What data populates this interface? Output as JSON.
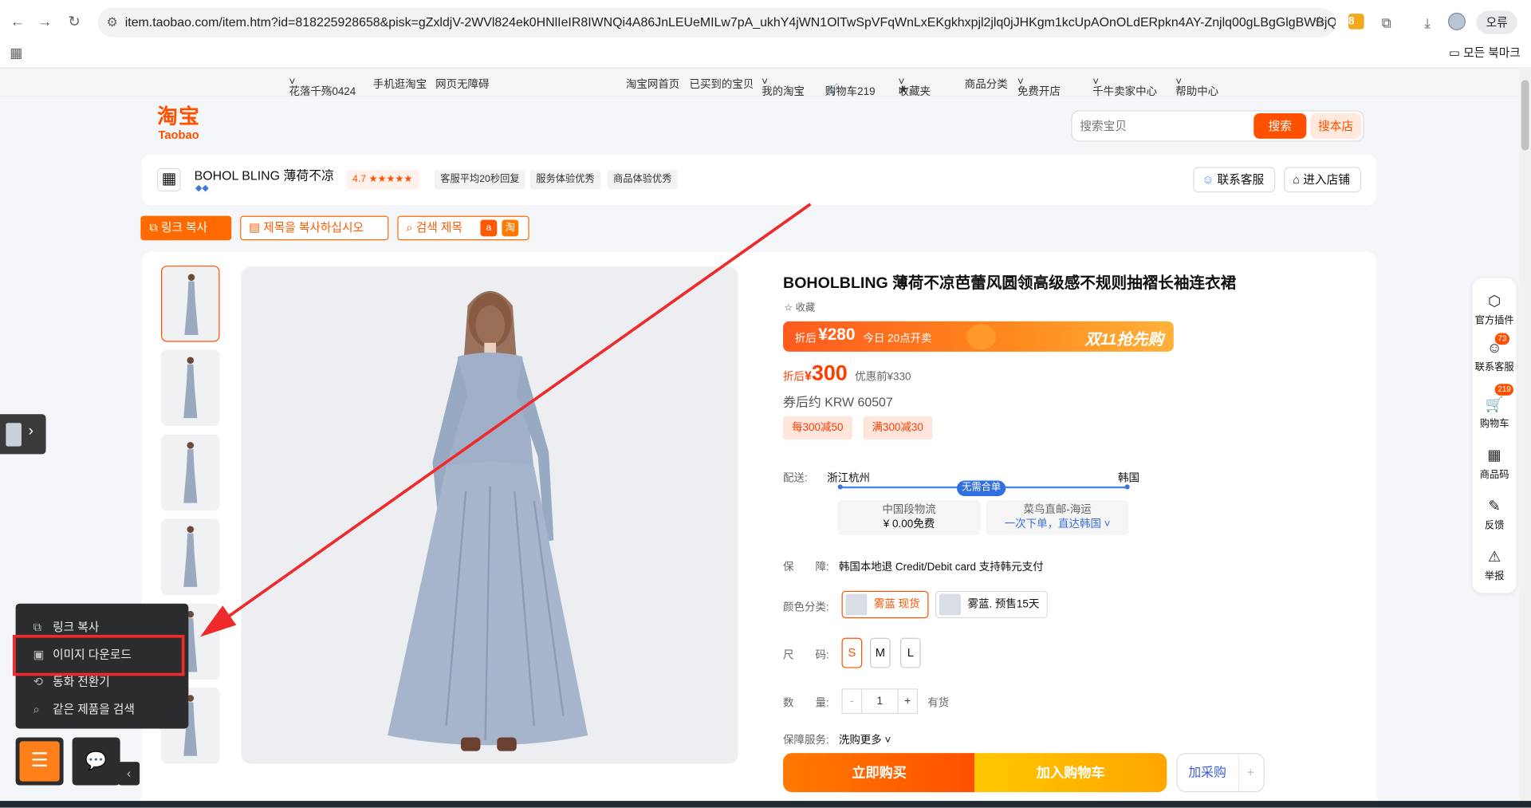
{
  "browser": {
    "url": "item.taobao.com/item.htm?id=818225928658&pisk=gZxldjV-2WVl824ek0HNlIeIR8IWNQi4A86JnLEUeMILw7pA_ukhY4jWN1OlTwSpVFqWnLxEKgkhxpjl2jlq0jJHKgm1kcUpAOnOLdERpkn4AY-Znjlq00gLBgGlgBWBjQqOhtl...",
    "extension_badge": "8",
    "update_label": "오류",
    "bookmarks_label": "모든 북마크"
  },
  "topnav": {
    "user": "花落千殇0424",
    "mobile": "手机逛淘宝",
    "accessible": "网页无障碍",
    "home": "淘宝网首页",
    "bought": "已买到的宝贝",
    "my_taobao": "我的淘宝",
    "cart": "购物车219",
    "favorites": "收藏夹",
    "categories": "商品分类",
    "open_shop": "免费开店",
    "seller_center": "千牛卖家中心",
    "help": "帮助中心"
  },
  "header": {
    "logo_cn": "淘宝",
    "logo_en": "Taobao",
    "search_placeholder": "搜索宝贝",
    "search_button": "搜索",
    "search_shop_button": "搜本店"
  },
  "shop": {
    "name": "BOHOL BLING 薄荷不凉",
    "rating": "4.7 ★★★★★",
    "tags": [
      "客服平均20秒回复",
      "服务体验优秀",
      "商品体验优秀"
    ],
    "contact_button": "联系客服",
    "enter_shop_button": "进入店铺"
  },
  "extension_toolbar": {
    "copy_link": "링크 복사",
    "copy_title": "제목을 복사하십시오",
    "search_title": "검색 제목"
  },
  "product": {
    "title": "BOHOLBLING 薄荷不凉芭蕾风圆领高级感不规则抽褶长袖连衣裙",
    "favorite": "收藏",
    "promo_prefix": "折后",
    "promo_price": "¥280",
    "promo_note": "今日 20点开卖",
    "promo_event": "双11抢先购",
    "price_prefix": "折后",
    "price_currency": "¥",
    "price": "300",
    "original_price": "优惠前¥330",
    "after_coupon": "券后约 KRW 60507",
    "coupons": [
      "每300减50",
      "满300减30"
    ],
    "shipping_label": "配送:",
    "ship_from": "浙江杭州",
    "ship_to": "韩国",
    "ship_badge": "无需合单",
    "ship_option1_title": "中国段物流",
    "ship_option1_value": "¥ 0.00免费",
    "ship_option2_title": "菜鸟直邮-海运",
    "ship_option2_value": "一次下单，直达韩国",
    "guarantee_label": "保　　障:",
    "guarantee_value": "韩国本地退 Credit/Debit card 支持韩元支付",
    "color_label": "颜色分类:",
    "colors": [
      "雾蓝 现货",
      "雾蓝. 预售15天"
    ],
    "size_label": "尺　　码:",
    "sizes": [
      "S",
      "M",
      "L"
    ],
    "qty_label": "数　　量:",
    "qty_minus": "-",
    "qty_value": "1",
    "qty_plus": "+",
    "stock": "有货",
    "service_label": "保障服务:",
    "service_value": "洗购更多",
    "buy_now": "立即购买",
    "add_to_cart": "加入购物车",
    "purchase": "加采购",
    "purchase_plus": "+"
  },
  "right_toolbar": {
    "items": [
      "官方插件",
      "联系客服",
      "购物车",
      "商品码",
      "反馈",
      "举报"
    ],
    "service_badge": "73",
    "cart_badge": "219"
  },
  "context_menu": {
    "items": [
      "링크 복사",
      "이미지 다운로드",
      "동화 전환기",
      "같은 제품을 검색"
    ]
  },
  "colors": {
    "brand": "#ff5000",
    "highlight": "#ee2a2a",
    "korean_toolbar": "#ff6a00"
  }
}
